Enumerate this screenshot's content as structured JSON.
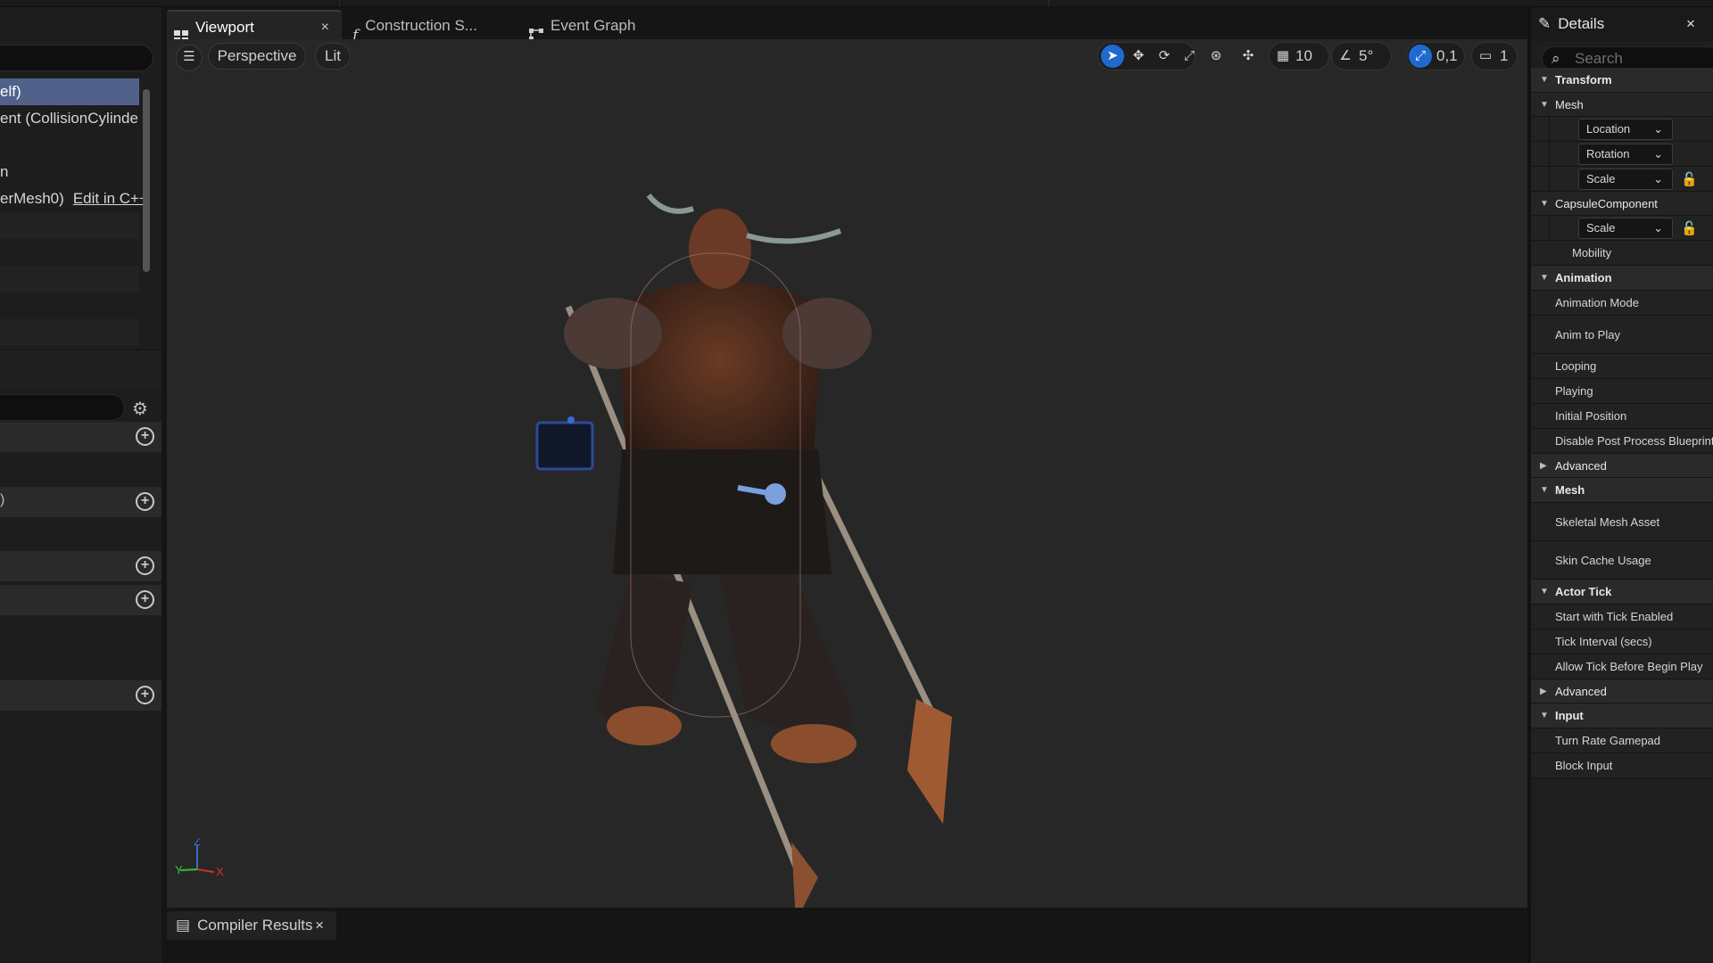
{
  "tabs": [
    {
      "label": "Viewport",
      "close": "×"
    },
    {
      "label": "Construction S...",
      "icon": "function-icon"
    },
    {
      "label": "Event Graph",
      "icon": "graph-icon"
    }
  ],
  "left_panel": {
    "tree_items": [
      {
        "text": "elf)"
      },
      {
        "text": "ent (CollisionCylinde"
      },
      {
        "text": ""
      },
      {
        "text": "n"
      },
      {
        "text": "erMesh0)",
        "link": "Edit in C++"
      }
    ],
    "variable_row_paren": ")"
  },
  "viewport_toolbar": {
    "perspective": "Perspective",
    "lit": "Lit",
    "grid_snap": "10",
    "rotation_snap": "5°",
    "scale_snap": "0,1",
    "camera_speed": "1"
  },
  "bottom": {
    "compiler_tab": "Compiler Results",
    "close": "×"
  },
  "details": {
    "title": "Details",
    "close": "×",
    "search_placeholder": "Search",
    "rows": [
      {
        "type": "cat",
        "label": "Transform"
      },
      {
        "type": "sub",
        "label": "Mesh"
      },
      {
        "type": "dropdown",
        "label": "Location"
      },
      {
        "type": "dropdown",
        "label": "Rotation"
      },
      {
        "type": "dropdown",
        "label": "Scale",
        "lock": true
      },
      {
        "type": "sub",
        "label": "CapsuleComponent"
      },
      {
        "type": "dropdown",
        "label": "Scale",
        "lock": true
      },
      {
        "type": "prop2",
        "label": "Mobility"
      },
      {
        "type": "cat",
        "label": "Animation"
      },
      {
        "type": "prop",
        "label": "Animation Mode"
      },
      {
        "type": "propTall",
        "label": "Anim to Play"
      },
      {
        "type": "prop",
        "label": "Looping"
      },
      {
        "type": "prop",
        "label": "Playing"
      },
      {
        "type": "prop",
        "label": "Initial Position"
      },
      {
        "type": "prop",
        "label": "Disable Post Process Blueprint"
      },
      {
        "type": "collapsed",
        "label": "Advanced"
      },
      {
        "type": "cat",
        "label": "Mesh"
      },
      {
        "type": "propTall",
        "label": "Skeletal Mesh Asset"
      },
      {
        "type": "propTall",
        "label": "Skin Cache Usage"
      },
      {
        "type": "cat",
        "label": "Actor Tick"
      },
      {
        "type": "prop",
        "label": "Start with Tick Enabled"
      },
      {
        "type": "prop",
        "label": "Tick Interval (secs)"
      },
      {
        "type": "prop",
        "label": "Allow Tick Before Begin Play"
      },
      {
        "type": "collapsed",
        "label": "Advanced"
      },
      {
        "type": "cat",
        "label": "Input"
      },
      {
        "type": "prop",
        "label": "Turn Rate Gamepad"
      },
      {
        "type": "prop",
        "label": "Block Input"
      }
    ]
  },
  "colors": {
    "accent": "#1e6ad0",
    "selection": "#50628a"
  }
}
